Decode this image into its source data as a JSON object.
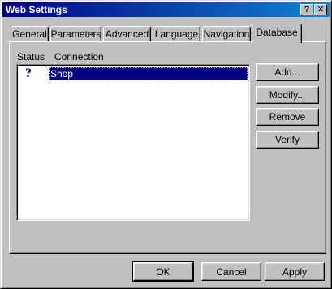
{
  "window": {
    "title": "Web Settings",
    "help_button": "?",
    "close_button": "✕"
  },
  "tabs": [
    {
      "label": "General",
      "active": false
    },
    {
      "label": "Parameters",
      "active": false
    },
    {
      "label": "Advanced",
      "active": false
    },
    {
      "label": "Language",
      "active": false
    },
    {
      "label": "Navigation",
      "active": false
    },
    {
      "label": "Database",
      "active": true
    }
  ],
  "list": {
    "columns": [
      "Status",
      "Connection"
    ],
    "rows": [
      {
        "status": "?",
        "connection": "Shop",
        "selected": true
      }
    ]
  },
  "side_buttons": {
    "add": "Add...",
    "modify": "Modify...",
    "remove": "Remove",
    "verify": "Verify"
  },
  "footer": {
    "ok": "OK",
    "cancel": "Cancel",
    "apply": "Apply"
  }
}
